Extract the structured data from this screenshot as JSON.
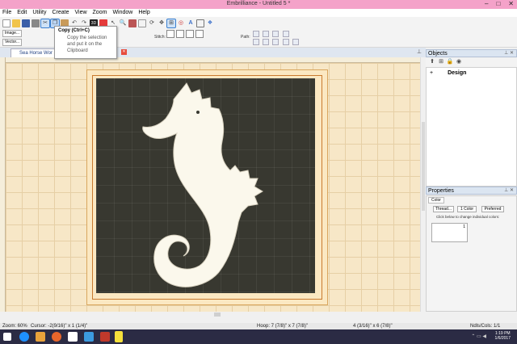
{
  "window": {
    "title": "Embrilliance - Untitled 5 *",
    "controls": [
      "–",
      "□",
      "✕"
    ]
  },
  "menu": [
    "File",
    "Edit",
    "Utility",
    "Create",
    "View",
    "Zoom",
    "Window",
    "Help"
  ],
  "toolbar": {
    "image_button": "Image...",
    "vector_button": "Vector...",
    "stitch_label": "Stitch:",
    "path_label": "Path:"
  },
  "tooltip": {
    "title": "Copy (Ctrl+C)",
    "body": [
      "Copy the selection",
      "and put it on the",
      "Clipboard"
    ]
  },
  "document_tab": {
    "label": "Sea Horse Wor"
  },
  "objects_panel": {
    "title": "Objects",
    "tree": [
      {
        "label": "Design",
        "expander": "+"
      }
    ]
  },
  "properties_panel": {
    "title": "Properties",
    "tab": "Color",
    "buttons": [
      "Thread...",
      "1 Color",
      "Preferred"
    ],
    "note": "Click below to change individual colors:",
    "swatch_number": "1"
  },
  "status": {
    "zoom": "Zoom: 60%",
    "cursor": "Cursor: -2(9/16)\" x 1 (1/4)\"",
    "hoop": "Hoop: 7 (7/8)\" x 7 (7/8)\"",
    "size": "4 (3/16)\" x 6 (7/8)\"",
    "ndls": "Ndls/Cols: 1/1"
  },
  "taskbar": {
    "time": "1:19 PM",
    "date": "1/6/2017"
  },
  "colors": {
    "titlebar": "#f4a2c9",
    "hoop_background": "#fbe8c2",
    "design_background": "#383830",
    "seahorse_fill": "#fbf8ec"
  }
}
